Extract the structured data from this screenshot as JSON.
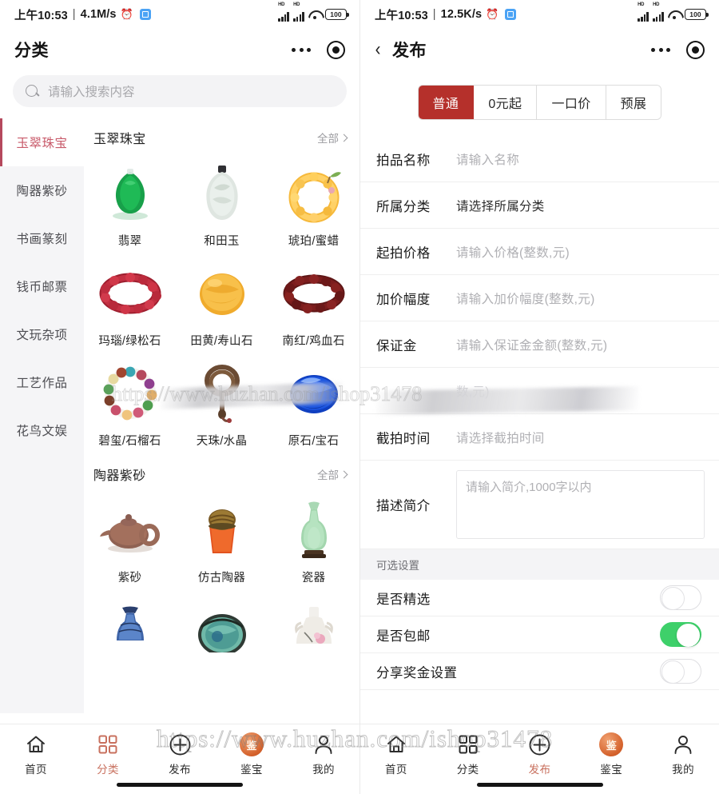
{
  "left": {
    "statusbar": {
      "time": "上午10:53",
      "separator": "|",
      "speed": "4.1M/s",
      "alarm_icon": "alarm-icon",
      "battery": "100"
    },
    "navbar": {
      "title": "分类",
      "more_icon": "more-dots-icon",
      "target_icon": "target-icon"
    },
    "search": {
      "placeholder": "请输入搜索内容",
      "icon": "search-icon"
    },
    "sidebar": {
      "items": [
        {
          "label": "玉翠珠宝",
          "active": true
        },
        {
          "label": "陶器紫砂",
          "active": false
        },
        {
          "label": "书画篆刻",
          "active": false
        },
        {
          "label": "钱币邮票",
          "active": false
        },
        {
          "label": "文玩杂项",
          "active": false
        },
        {
          "label": "工艺作品",
          "active": false
        },
        {
          "label": "花鸟文娱",
          "active": false
        }
      ]
    },
    "sections": [
      {
        "title": "玉翠珠宝",
        "all_label": "全部",
        "items": [
          {
            "label": "翡翠",
            "icon": "jade-pendant"
          },
          {
            "label": "和田玉",
            "icon": "hetian-jade"
          },
          {
            "label": "琥珀/蜜蜡",
            "icon": "amber-bracelet"
          },
          {
            "label": "玛瑙/绿松石",
            "icon": "agate-bracelet"
          },
          {
            "label": "田黄/寿山石",
            "icon": "shoushan-stone"
          },
          {
            "label": "南红/鸡血石",
            "icon": "nanhong-bracelet"
          },
          {
            "label": "碧玺/石榴石",
            "icon": "tourmaline-bracelet"
          },
          {
            "label": "天珠/水晶",
            "icon": "dzi-beads"
          },
          {
            "label": "原石/宝石",
            "icon": "blue-gemstone"
          }
        ]
      },
      {
        "title": "陶器紫砂",
        "all_label": "全部",
        "items": [
          {
            "label": "紫砂",
            "icon": "zisha-teapot"
          },
          {
            "label": "仿古陶器",
            "icon": "antique-pottery"
          },
          {
            "label": "瓷器",
            "icon": "celadon-vase"
          },
          {
            "label": "",
            "icon": "blue-white-vase"
          },
          {
            "label": "",
            "icon": "green-glazed-jar"
          },
          {
            "label": "",
            "icon": "famille-rose-vase"
          }
        ]
      }
    ],
    "tabbar": [
      {
        "label": "首页",
        "icon": "home-icon",
        "active": false
      },
      {
        "label": "分类",
        "icon": "grid-icon",
        "active": true
      },
      {
        "label": "发布",
        "icon": "plus-circle-icon",
        "active": false
      },
      {
        "label": "鉴宝",
        "icon": "gem-appraisal-icon",
        "active": false
      },
      {
        "label": "我的",
        "icon": "user-icon",
        "active": false
      }
    ]
  },
  "right": {
    "statusbar": {
      "time": "上午10:53",
      "separator": "|",
      "speed": "12.5K/s",
      "alarm_icon": "alarm-icon",
      "battery": "100"
    },
    "navbar": {
      "back_icon": "chevron-left-icon",
      "title": "发布",
      "more_icon": "more-dots-icon",
      "target_icon": "target-icon"
    },
    "segments": [
      {
        "label": "普通",
        "active": true
      },
      {
        "label": "0元起",
        "active": false
      },
      {
        "label": "一口价",
        "active": false
      },
      {
        "label": "预展",
        "active": false
      }
    ],
    "form": [
      {
        "label": "拍品名称",
        "value": "请输入名称",
        "strong": false,
        "obscured": false
      },
      {
        "label": "所属分类",
        "value": "请选择所属分类",
        "strong": true,
        "obscured": false
      },
      {
        "label": "起拍价格",
        "value": "请输入价格(整数,元)",
        "strong": false,
        "obscured": false
      },
      {
        "label": "加价幅度",
        "value": "请输入加价幅度(整数,元)",
        "strong": false,
        "obscured": false
      },
      {
        "label": "保证金",
        "value": "请输入保证金金额(整数,元)",
        "strong": false,
        "obscured": false
      },
      {
        "label": "",
        "value": "数,元)",
        "strong": false,
        "obscured": true
      },
      {
        "label": "截拍时间",
        "value": "请选择截拍时间",
        "strong": false,
        "obscured": false
      }
    ],
    "description": {
      "label": "描述简介",
      "placeholder": "请输入简介,1000字以内"
    },
    "optional": {
      "section_title": "可选设置",
      "toggles": [
        {
          "label": "是否精选",
          "on": false
        },
        {
          "label": "是否包邮",
          "on": true
        },
        {
          "label": "分享奖金设置",
          "on": false
        }
      ]
    },
    "tabbar": [
      {
        "label": "首页",
        "icon": "home-icon",
        "active": false
      },
      {
        "label": "分类",
        "icon": "grid-icon",
        "active": false
      },
      {
        "label": "发布",
        "icon": "plus-circle-icon",
        "active": true
      },
      {
        "label": "鉴宝",
        "icon": "gem-appraisal-icon",
        "active": false
      },
      {
        "label": "我的",
        "icon": "user-icon",
        "active": false
      }
    ]
  },
  "watermark": {
    "url": "https://www.huzhan.com/ishop31478"
  },
  "colors": {
    "accent_red": "#b5302b",
    "sidebar_active": "#c85a6a",
    "tab_active": "#c8705e",
    "toggle_on": "#3ed06a"
  }
}
